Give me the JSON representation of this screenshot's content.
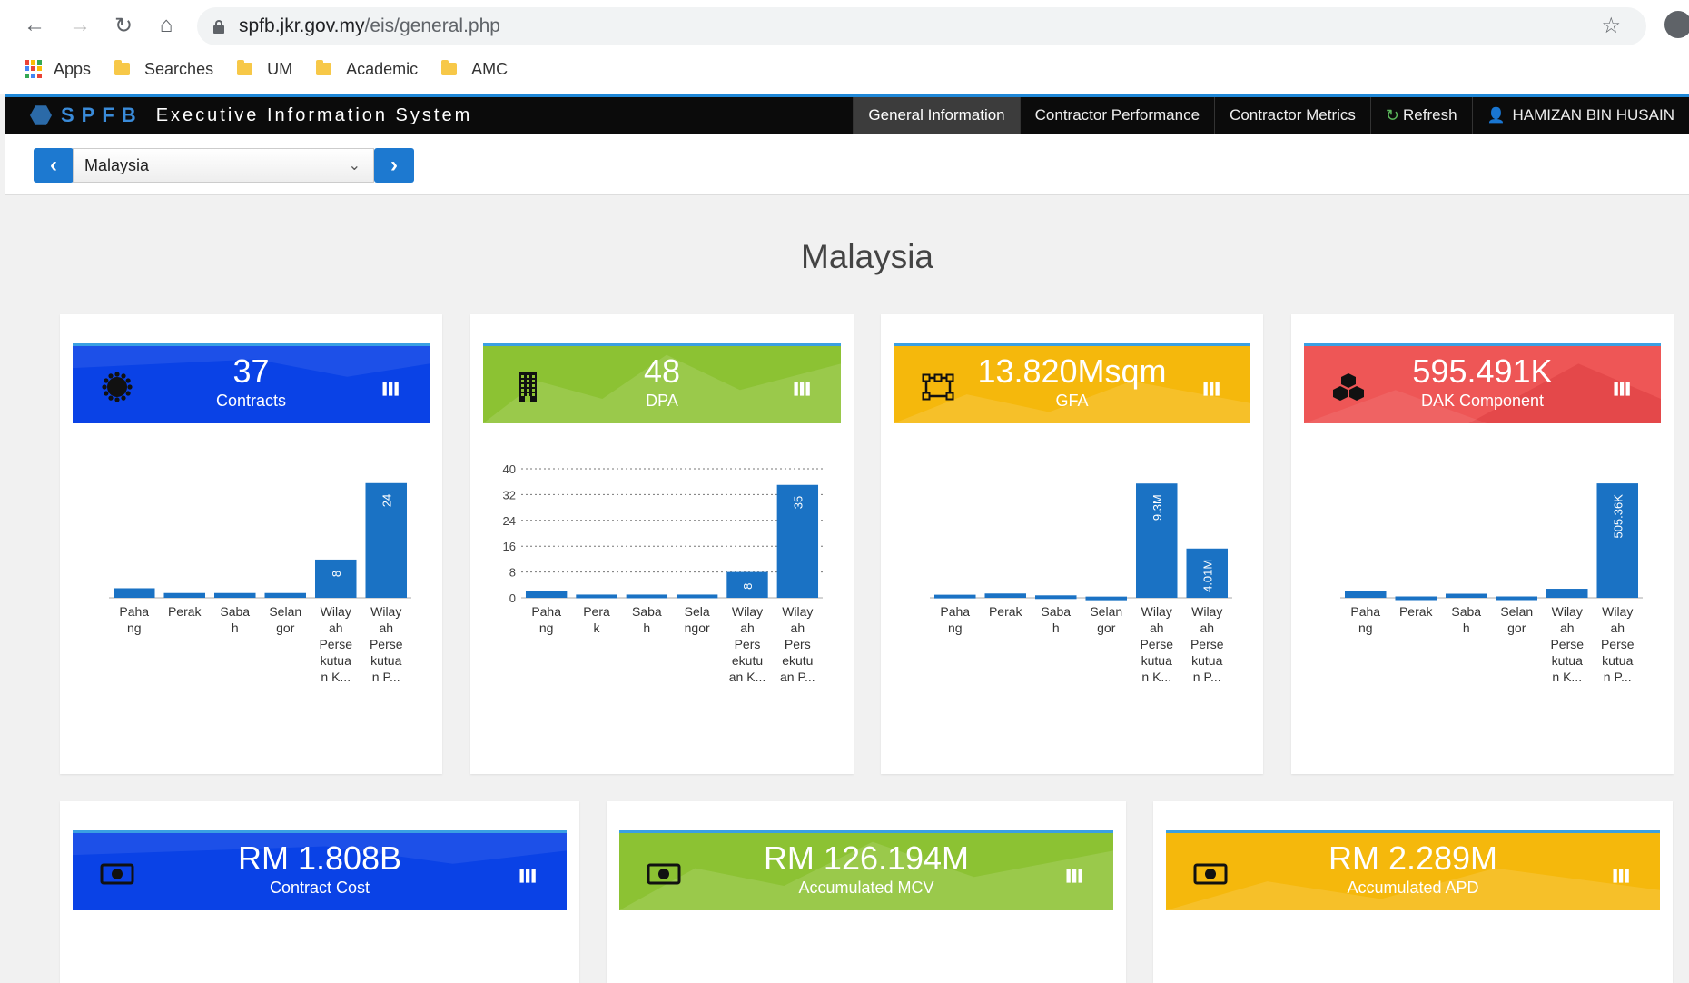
{
  "browser": {
    "url_host": "spfb.jkr.gov.my",
    "url_path": "/eis/general.php",
    "bookmarks": [
      {
        "label": "Apps",
        "icon": "apps-grid-icon"
      },
      {
        "label": "Searches",
        "icon": "folder-icon"
      },
      {
        "label": "UM",
        "icon": "folder-icon"
      },
      {
        "label": "Academic",
        "icon": "folder-icon"
      },
      {
        "label": "AMC",
        "icon": "folder-icon"
      }
    ]
  },
  "app": {
    "brand": "SPFB",
    "subtitle": "Executive Information System",
    "nav": [
      "General Information",
      "Contractor Performance",
      "Contractor Metrics",
      "Refresh",
      "HAMIZAN BIN HUSAIN"
    ],
    "active_nav": "General Information"
  },
  "toolbar": {
    "selected_region": "Malaysia"
  },
  "page_title": "Malaysia",
  "colors": {
    "blue": "#0a42e6",
    "green": "#8cc233",
    "yellow": "#f5b80c",
    "red": "#ee5656",
    "bar": "#1a72c4"
  },
  "cards": [
    {
      "value": "37",
      "label": "Contracts",
      "color": "blue",
      "icon": "gear-icon"
    },
    {
      "value": "48",
      "label": "DPA",
      "color": "green",
      "icon": "building-icon"
    },
    {
      "value": "13.820Msqm",
      "label": "GFA",
      "color": "yellow",
      "icon": "vector-area-icon"
    },
    {
      "value": "595.491K",
      "label": "DAK Component",
      "color": "red",
      "icon": "cubes-icon"
    }
  ],
  "cards_row2": [
    {
      "value": "RM 1.808B",
      "label": "Contract Cost",
      "color": "blue",
      "icon": "money-icon"
    },
    {
      "value": "RM 126.194M",
      "label": "Accumulated MCV",
      "color": "green",
      "icon": "money-icon"
    },
    {
      "value": "RM 2.289M",
      "label": "Accumulated APD",
      "color": "yellow",
      "icon": "money-icon"
    }
  ],
  "chart_data": [
    {
      "type": "bar",
      "categories": [
        [
          "Paha",
          "ng"
        ],
        [
          "Perak"
        ],
        [
          "Saba",
          "h"
        ],
        [
          "Selan",
          "gor"
        ],
        [
          "Wilay",
          "ah",
          "Perse",
          "kutua",
          "n K..."
        ],
        [
          "Wilay",
          "ah",
          "Perse",
          "kutua",
          "n P..."
        ]
      ],
      "values": [
        2,
        1,
        1,
        1,
        8,
        24
      ],
      "data_labels": [
        "",
        "",
        "",
        "",
        "8",
        "24"
      ],
      "ylim": [
        0,
        27
      ],
      "yticks": []
    },
    {
      "type": "bar",
      "categories": [
        [
          "Paha",
          "ng"
        ],
        [
          "Pera",
          "k"
        ],
        [
          "Saba",
          "h"
        ],
        [
          "Sela",
          "ngor"
        ],
        [
          "Wilay",
          "ah",
          "Pers",
          "ekutu",
          "an K..."
        ],
        [
          "Wilay",
          "ah",
          "Pers",
          "ekutu",
          "an P..."
        ]
      ],
      "values": [
        2,
        1,
        1,
        1,
        8,
        35
      ],
      "data_labels": [
        "",
        "",
        "",
        "",
        "8",
        "35"
      ],
      "ylim": [
        0,
        40
      ],
      "yticks": [
        "0",
        "8",
        "16",
        "24",
        "32",
        "40"
      ],
      "grid": true
    },
    {
      "type": "bar",
      "categories": [
        [
          "Paha",
          "ng"
        ],
        [
          "Perak"
        ],
        [
          "Saba",
          "h"
        ],
        [
          "Selan",
          "gor"
        ],
        [
          "Wilay",
          "ah",
          "Perse",
          "kutua",
          "n K..."
        ],
        [
          "Wilay",
          "ah",
          "Perse",
          "kutua",
          "n P..."
        ]
      ],
      "values": [
        0.25,
        0.35,
        0.2,
        0.1,
        9.3,
        4.01
      ],
      "data_labels": [
        "",
        "",
        "",
        "",
        "9.3M",
        "4.01M"
      ],
      "ylim": [
        0,
        10.5
      ],
      "yticks": []
    },
    {
      "type": "bar",
      "categories": [
        [
          "Paha",
          "ng"
        ],
        [
          "Perak"
        ],
        [
          "Saba",
          "h"
        ],
        [
          "Selan",
          "gor"
        ],
        [
          "Wilay",
          "ah",
          "Perse",
          "kutua",
          "n K..."
        ],
        [
          "Wilay",
          "ah",
          "Perse",
          "kutua",
          "n P..."
        ]
      ],
      "values": [
        32,
        6,
        18,
        6,
        40,
        505.36
      ],
      "data_labels": [
        "",
        "",
        "",
        "",
        "",
        "505.36K"
      ],
      "ylim": [
        0,
        570
      ],
      "yticks": []
    }
  ]
}
